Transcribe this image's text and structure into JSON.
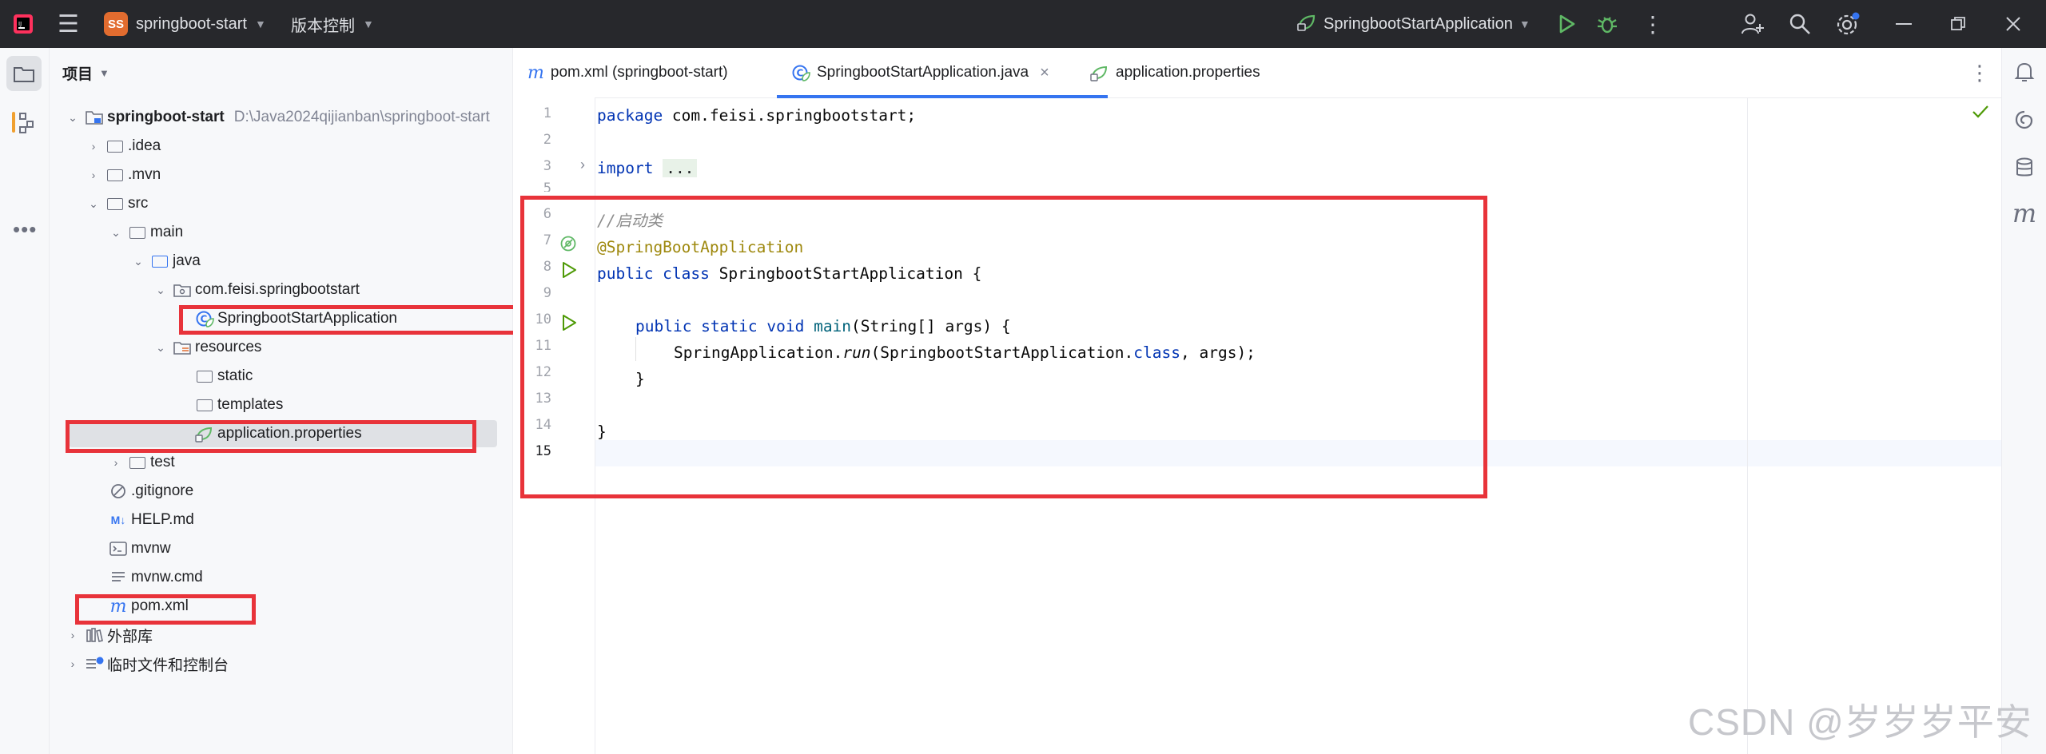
{
  "titlebar": {
    "project_badge": "SS",
    "project_name": "springboot-start",
    "vcs_label": "版本控制",
    "run_config": "SpringbootStartApplication",
    "colors": {
      "background": "#27282c",
      "badge": "#e26c2f",
      "run": "#5fb865"
    }
  },
  "project_panel": {
    "header": "项目",
    "root_name": "springboot-start",
    "root_path": "D:\\Java2024qijianban\\springboot-start",
    "tree": [
      {
        "label": ".idea",
        "icon": "folder-icon"
      },
      {
        "label": ".mvn",
        "icon": "folder-icon"
      },
      {
        "label": "src",
        "icon": "folder-icon"
      },
      {
        "label": "main",
        "icon": "folder-icon"
      },
      {
        "label": "java",
        "icon": "source-folder-icon"
      },
      {
        "label": "com.feisi.springbootstart",
        "icon": "package-icon"
      },
      {
        "label": "SpringbootStartApplication",
        "icon": "spring-class-icon"
      },
      {
        "label": "resources",
        "icon": "resources-folder-icon"
      },
      {
        "label": "static",
        "icon": "folder-icon"
      },
      {
        "label": "templates",
        "icon": "folder-icon"
      },
      {
        "label": "application.properties",
        "icon": "spring-properties-icon"
      },
      {
        "label": "test",
        "icon": "folder-icon"
      },
      {
        "label": ".gitignore",
        "icon": "ignore-file-icon"
      },
      {
        "label": "HELP.md",
        "icon": "markdown-icon"
      },
      {
        "label": "mvnw",
        "icon": "terminal-file-icon"
      },
      {
        "label": "mvnw.cmd",
        "icon": "text-file-icon"
      },
      {
        "label": "pom.xml",
        "icon": "maven-icon"
      },
      {
        "label": "外部库",
        "icon": "library-icon"
      },
      {
        "label": "临时文件和控制台",
        "icon": "scratch-icon"
      }
    ]
  },
  "tabs": [
    {
      "label": "pom.xml (springboot-start)",
      "icon": "maven-icon"
    },
    {
      "label": "SpringbootStartApplication.java",
      "icon": "spring-class-icon",
      "active": true
    },
    {
      "label": "application.properties",
      "icon": "spring-properties-icon"
    }
  ],
  "editor": {
    "line_numbers": [
      "1",
      "2",
      "3",
      "5",
      "6",
      "7",
      "8",
      "9",
      "10",
      "11",
      "12",
      "13",
      "14",
      "15"
    ],
    "lines": {
      "l1_kw": "package",
      "l1_rest": " com.feisi.springbootstart;",
      "l3_kw": "import",
      "l3_fold": "...",
      "l6_comment": "//启动类",
      "l7_annotation": "@SpringBootApplication",
      "l8_kw": "public class",
      "l8_rest": " SpringbootStartApplication {",
      "l10_kw": "public static void",
      "l10_fn": "main",
      "l10_rest": "(String[] args) {",
      "l11_pre": "SpringApplication.",
      "l11_call": "run",
      "l11_mid": "(SpringbootStartApplication.",
      "l11_kw": "class",
      "l11_post": ", args);",
      "l12": "}",
      "l14": "}"
    }
  },
  "watermark": "CSDN @岁岁岁平安",
  "highlight_color": "#e8333a"
}
